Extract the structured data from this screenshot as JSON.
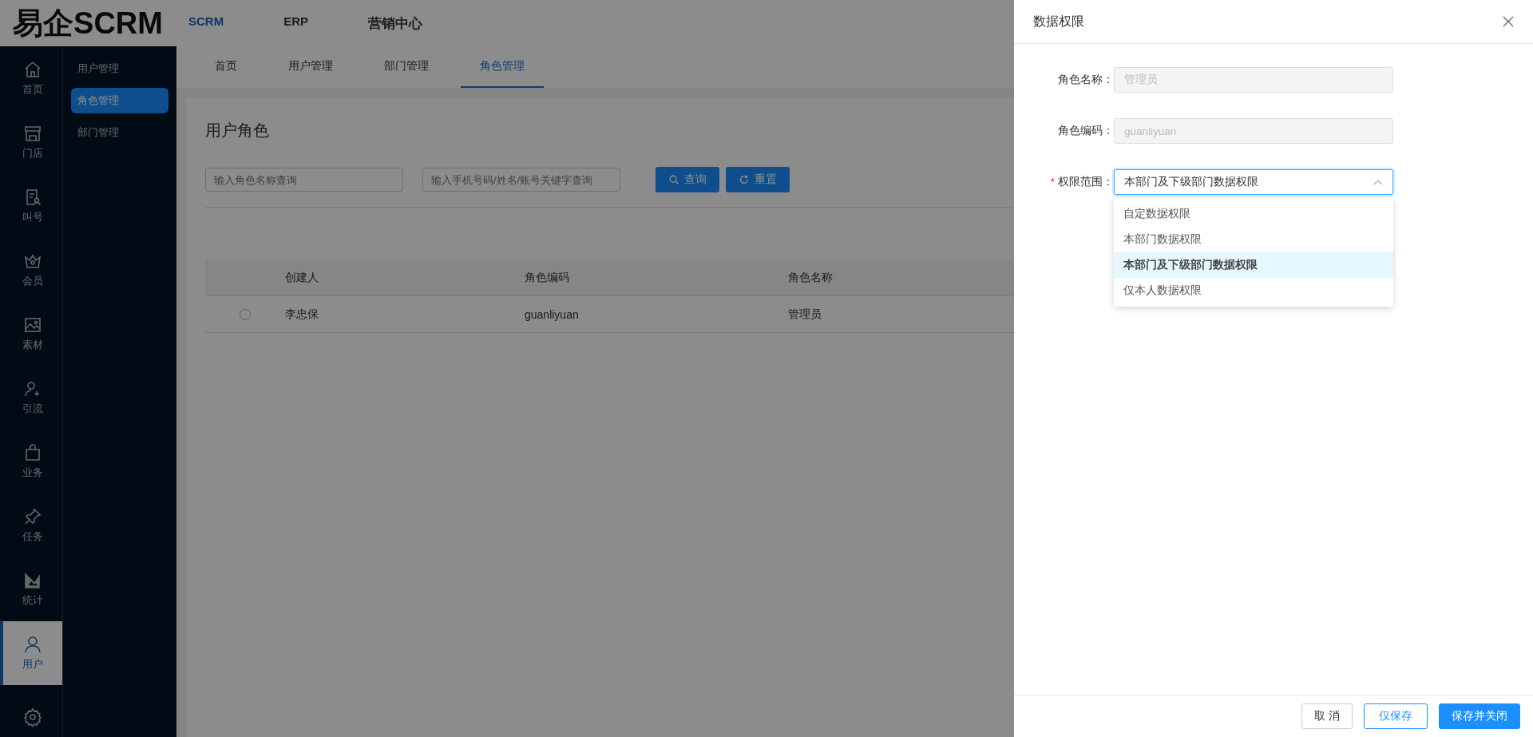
{
  "header": {
    "logo": "易企SCRM",
    "nav": [
      {
        "label": "SCRM",
        "selected": true
      },
      {
        "label": "ERP",
        "selected": false
      },
      {
        "label": "营销中心",
        "selected": false
      }
    ]
  },
  "rail": [
    {
      "label": "首页",
      "selected": false
    },
    {
      "label": "门店",
      "selected": false
    },
    {
      "label": "叫号",
      "selected": false
    },
    {
      "label": "会员",
      "selected": false
    },
    {
      "label": "素材",
      "selected": false
    },
    {
      "label": "引流",
      "selected": false
    },
    {
      "label": "业务",
      "selected": false
    },
    {
      "label": "任务",
      "selected": false
    },
    {
      "label": "统计",
      "selected": false
    },
    {
      "label": "用户",
      "selected": true
    }
  ],
  "submenu": [
    {
      "label": "用户管理",
      "selected": false
    },
    {
      "label": "角色管理",
      "selected": true
    },
    {
      "label": "部门管理",
      "selected": false
    }
  ],
  "tabs": [
    {
      "label": "首页",
      "selected": false
    },
    {
      "label": "用户管理",
      "selected": false
    },
    {
      "label": "部门管理",
      "selected": false
    },
    {
      "label": "角色管理",
      "selected": true
    }
  ],
  "card": {
    "title": "用户角色",
    "filters": [
      {
        "placeholder": "输入角色名称查询"
      },
      {
        "placeholder": "输入手机号码/姓名/账号关键字查询"
      }
    ],
    "buttons": [
      "查询",
      "重置"
    ],
    "table": {
      "columns": [
        "创建人",
        "角色编码",
        "角色名称"
      ],
      "rows": [
        {
          "selected": false,
          "cells": [
            "李忠保",
            "guanliyuan",
            "管理员"
          ]
        }
      ]
    }
  },
  "drawer": {
    "title": "数据权限",
    "fields": [
      {
        "label": "角色名称：",
        "value": "管理员",
        "disabled": true
      },
      {
        "label": "角色编码：",
        "value": "guanliyuan",
        "disabled": true
      }
    ],
    "select": {
      "required_mark": "*",
      "label": "权限范围：",
      "value": "本部门及下级部门数据权限",
      "expanded": true,
      "options": [
        {
          "label": "自定数据权限",
          "selected": false
        },
        {
          "label": "本部门数据权限",
          "selected": false
        },
        {
          "label": "本部门及下级部门数据权限",
          "selected": true
        },
        {
          "label": "仅本人数据权限",
          "selected": false
        }
      ]
    },
    "footer": [
      {
        "label": "取 消",
        "kind": "default"
      },
      {
        "label": "仅保存",
        "kind": "outline"
      },
      {
        "label": "保存并关闭",
        "kind": "primary"
      }
    ]
  }
}
